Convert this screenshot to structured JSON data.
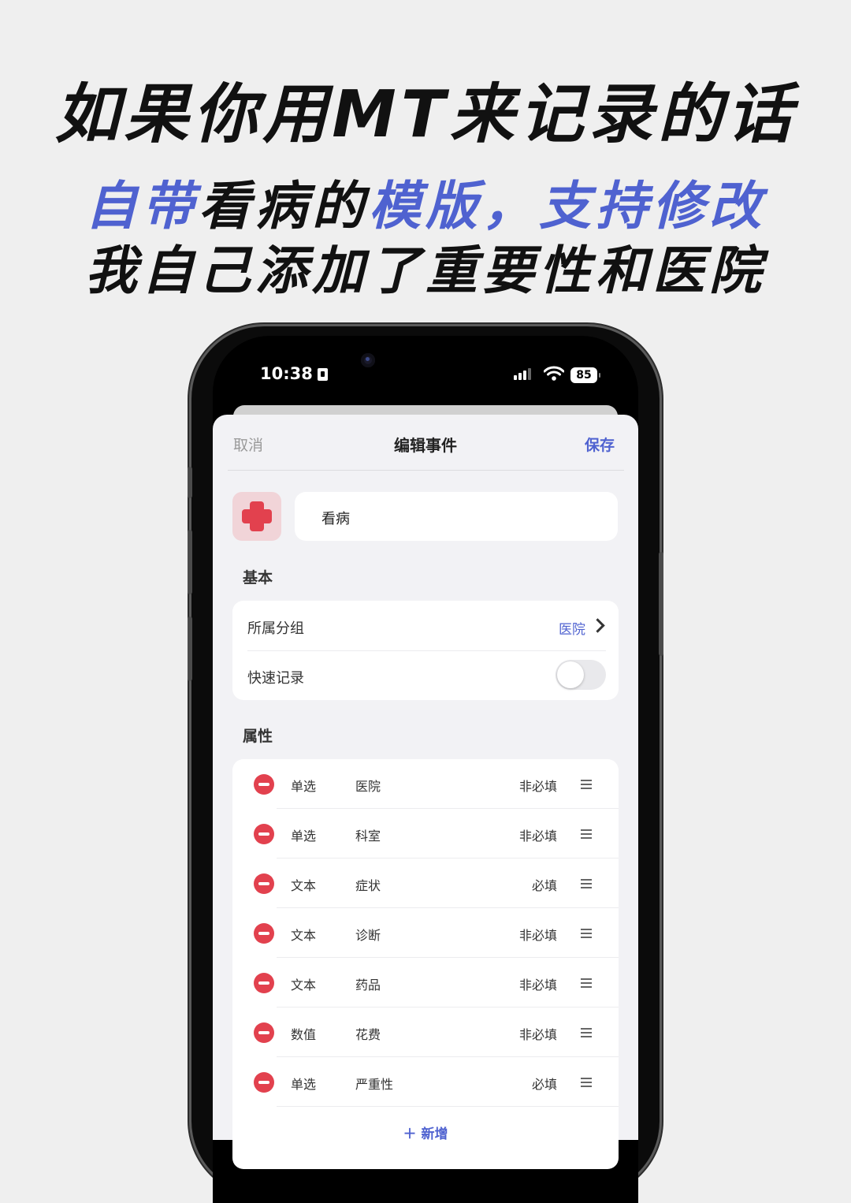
{
  "headline": {
    "line1": "如果你用MT来记录的话",
    "line2_parts": [
      "自带",
      "看病的",
      "模版，",
      "支持修改"
    ],
    "line3": "我自己添加了重要性和医院"
  },
  "status_bar": {
    "time": "10:38",
    "battery": "85"
  },
  "nav": {
    "cancel": "取消",
    "title": "编辑事件",
    "save": "保存"
  },
  "event": {
    "name": "看病",
    "icon": "medical-cross-icon"
  },
  "basic": {
    "label": "基本",
    "group_label": "所属分组",
    "group_value": "医院",
    "quick_label": "快速记录",
    "quick_on": false
  },
  "attributes": {
    "label": "属性",
    "items": [
      {
        "type": "单选",
        "name": "医院",
        "required": "非必填"
      },
      {
        "type": "单选",
        "name": "科室",
        "required": "非必填"
      },
      {
        "type": "文本",
        "name": "症状",
        "required": "必填"
      },
      {
        "type": "文本",
        "name": "诊断",
        "required": "非必填"
      },
      {
        "type": "文本",
        "name": "药品",
        "required": "非必填"
      },
      {
        "type": "数值",
        "name": "花费",
        "required": "非必填"
      },
      {
        "type": "单选",
        "name": "严重性",
        "required": "必填"
      }
    ],
    "add_label": "＋ 新增"
  },
  "colors": {
    "accent": "#4f62d0",
    "danger": "#e2414e",
    "background": "#efefef"
  }
}
